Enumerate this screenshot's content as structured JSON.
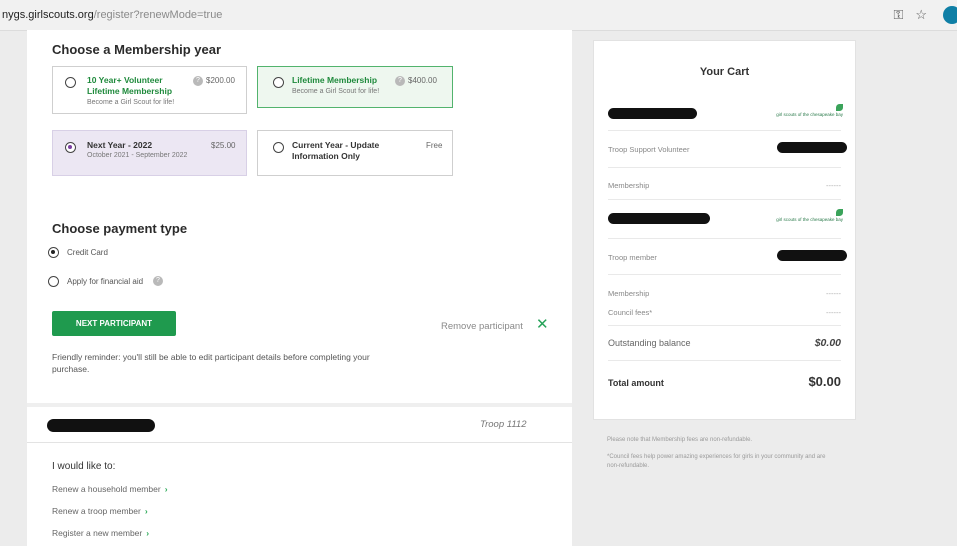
{
  "browser": {
    "url_host": "nygs.girlscouts.org",
    "url_path": "/register?renewMode=true",
    "key_icon": "key-icon",
    "star_icon": "star-icon"
  },
  "membership": {
    "title": "Choose a Membership year",
    "options": [
      {
        "title": "10 Year+ Volunteer Lifetime Membership",
        "sub": "Become a Girl Scout for life!",
        "price": "$200.00",
        "selected": false
      },
      {
        "title": "Lifetime Membership",
        "sub": "Become a Girl Scout for life!",
        "price": "$400.00",
        "selected": false
      },
      {
        "title": "Next Year - 2022",
        "sub": "October 2021 - September 2022",
        "price": "$25.00",
        "selected": true
      },
      {
        "title": "Current Year - Update Information Only",
        "sub": "",
        "price": "Free",
        "selected": false
      }
    ]
  },
  "payment": {
    "title": "Choose payment type",
    "options": [
      {
        "label": "Credit Card",
        "selected": true
      },
      {
        "label": "Apply for financial aid",
        "selected": false
      }
    ]
  },
  "actions": {
    "next_label": "NEXT PARTICIPANT",
    "remove_label": "Remove participant",
    "reminder": "Friendly reminder: you'll still be able to edit participant details before completing your purchase."
  },
  "participant": {
    "troop": "Troop 1112"
  },
  "like": {
    "title": "I would like to:",
    "links": [
      "Renew a household member",
      "Renew a troop member",
      "Register a new member"
    ]
  },
  "cart": {
    "title": "Your Cart",
    "logo_text": "girl scouts of the chesapeake bay",
    "rows": [
      {
        "label": "Troop Support Volunteer"
      },
      {
        "label": "Membership",
        "value": "------"
      },
      {
        "label": "Troop member"
      },
      {
        "label": "Membership",
        "value": "------"
      },
      {
        "label": "Council fees*",
        "value": "------"
      }
    ],
    "outstanding_label": "Outstanding balance",
    "outstanding_value": "$0.00",
    "total_label": "Total amount",
    "total_value": "$0.00"
  },
  "notes": {
    "n1": "Please note that Membership fees are non-refundable.",
    "n2": "*Council fees help power amazing experiences for girls in your community and are non-refundable."
  },
  "colors": {
    "green": "#1f9a4e",
    "purple_selected": "#ece7f3",
    "lifetime_green": "#eef7ef"
  }
}
